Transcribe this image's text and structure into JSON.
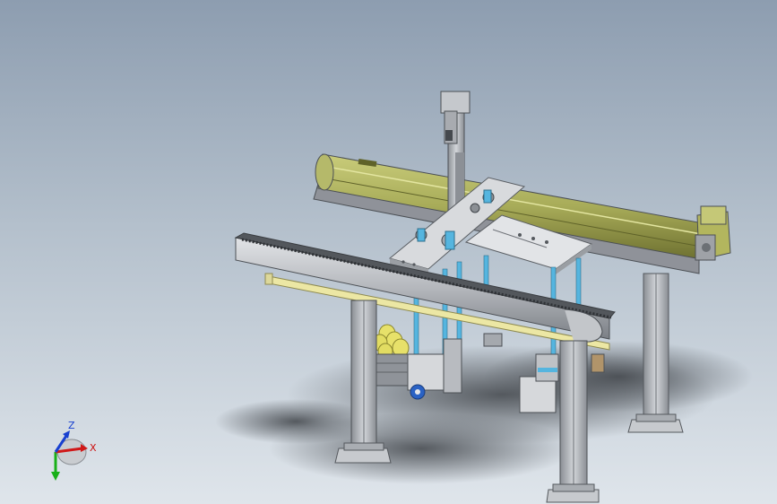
{
  "viewport": {
    "background_top": "#8d9db0",
    "background_bottom": "#dfe5eb"
  },
  "model": {
    "colors": {
      "frame": "#b9bcc1",
      "frame_dark": "#7f8389",
      "rail_olive": "#a7ab58",
      "rail_olive_dark": "#6d7030",
      "plate": "#d4d6d9",
      "rod_blue": "#55b5df",
      "yellow_bar": "#ece7a4",
      "roller_yellow": "#e7e16a",
      "shadow": "#4f5358"
    }
  },
  "triad": {
    "x_label": "X",
    "z_label": "Z",
    "x_color": "#d01818",
    "y_color": "#18b018",
    "z_color": "#1840d0"
  }
}
